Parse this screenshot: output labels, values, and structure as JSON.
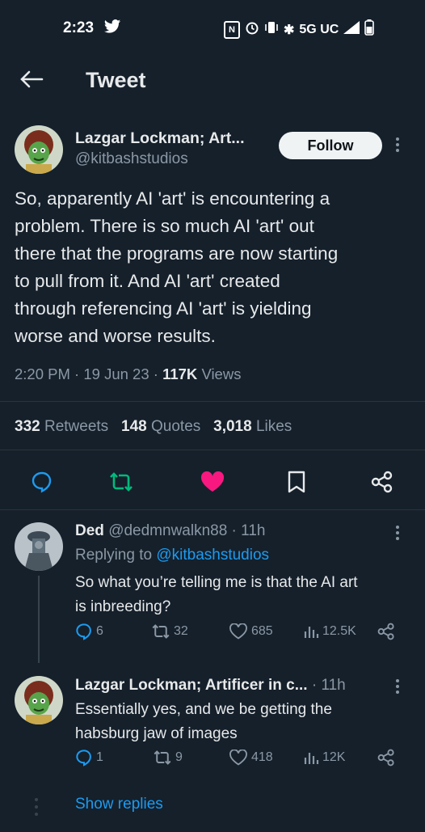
{
  "status_bar": {
    "time": "2:23",
    "network": "5G UC"
  },
  "header": {
    "title": "Tweet"
  },
  "tweet": {
    "author_name": "Lazgar Lockman; Art...",
    "handle": "@kitbashstudios",
    "follow_label": "Follow",
    "text": "So, apparently AI 'art' is encountering a\nproblem.  There is so much AI 'art' out\nthere that the programs are now starting\nto pull from it.  And AI 'art' created\nthrough referencing AI 'art' is yielding\nworse and worse results.",
    "time": "2:20 PM",
    "date": "19 Jun 23",
    "views_count": "117K",
    "views_label": "Views",
    "retweets_count": "332",
    "retweets_label": "Retweets",
    "quotes_count": "148",
    "quotes_label": "Quotes",
    "likes_count": "3,018",
    "likes_label": "Likes"
  },
  "replies": [
    {
      "name": "Ded",
      "handle": "@dedmnwalkn88",
      "age": "11h",
      "replying_to_label": "Replying to",
      "replying_to_handle": "@kitbashstudios",
      "text": "So what you’re telling me is that the AI art\nis inbreeding?",
      "reply_count": "6",
      "retweet_count": "32",
      "like_count": "685",
      "view_count": "12.5K"
    },
    {
      "name": "Lazgar Lockman; Artificer in c...",
      "age": "11h",
      "text": "Essentially yes, and we be getting the\nhabsburg jaw of images",
      "reply_count": "1",
      "retweet_count": "9",
      "like_count": "418",
      "view_count": "12K"
    }
  ],
  "show_replies": "Show replies",
  "colors": {
    "background": "#15202b",
    "accent": "#1d9bf0",
    "retweet_green": "#00ba7c",
    "like_pink": "#f91880"
  }
}
